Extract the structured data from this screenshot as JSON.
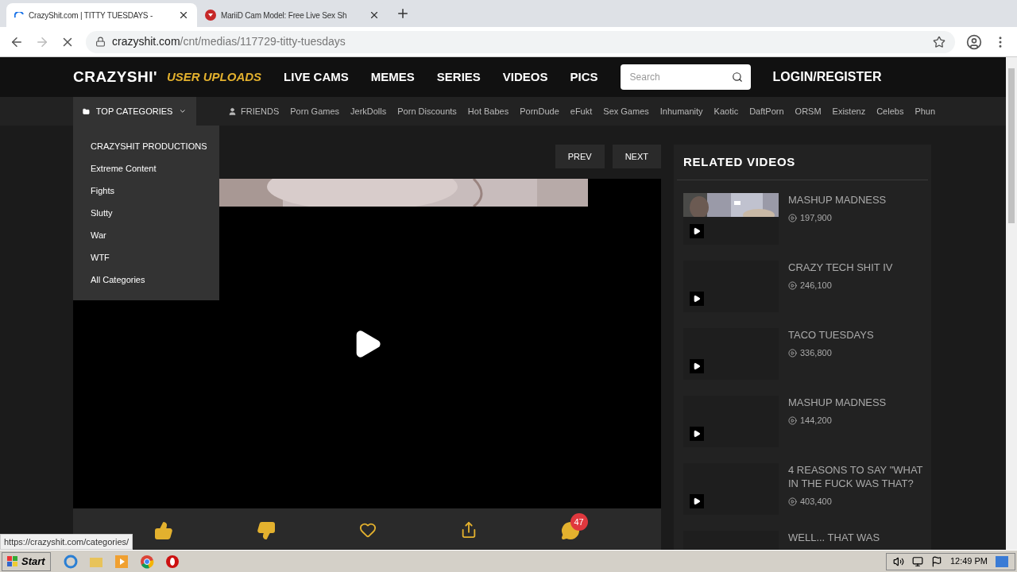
{
  "browser": {
    "tabs": [
      {
        "title": "CrazyShit.com | TITTY TUESDAYS -",
        "selected": true,
        "kind": "loading"
      },
      {
        "title": "MariiD Cam Model: Free Live Sex Sh",
        "selected": false,
        "kind": "site"
      }
    ],
    "url_host": "crazyshit.com",
    "url_path": "/cnt/medias/117729-titty-tuesdays",
    "loading": true
  },
  "navbar": {
    "logo": "CRAZYSHI'",
    "tagline": "USER UPLOADS",
    "links": [
      "LIVE CAMS",
      "MEMES",
      "SERIES",
      "VIDEOS",
      "PICS"
    ],
    "search": {
      "placeholder": "Search"
    },
    "login": "LOGIN/REGISTER"
  },
  "subnav": {
    "categories_button": "TOP CATEGORIES",
    "expanded": true,
    "friends": "FRIENDS",
    "links": [
      "Porn Games",
      "JerkDolls",
      "Porn Discounts",
      "Hot Babes",
      "PornDude",
      "eFukt",
      "Sex Games",
      "Inhumanity",
      "Kaotic",
      "DaftPorn",
      "ORSM",
      "Existenz",
      "Celebs",
      "Phun"
    ]
  },
  "categories_menu": [
    "CRAZYSHIT PRODUCTIONS",
    "Extreme Content",
    "Fights",
    "Slutty",
    "War",
    "WTF",
    "All Categories"
  ],
  "video": {
    "prev": "PREV",
    "next": "NEXT",
    "comment_count": "47"
  },
  "related": {
    "title": "RELATED VIDEOS",
    "items": [
      {
        "title": "MASHUP MADNESS",
        "views": "197,900",
        "thumb_loaded": true
      },
      {
        "title": "CRAZY TECH SHIT IV",
        "views": "246,100",
        "thumb_loaded": false
      },
      {
        "title": "TACO TUESDAYS",
        "views": "336,800",
        "thumb_loaded": false
      },
      {
        "title": "MASHUP MADNESS",
        "views": "144,200",
        "thumb_loaded": false
      },
      {
        "title": "4 REASONS TO SAY \"WHAT IN THE FUCK WAS THAT?",
        "views": "403,400",
        "thumb_loaded": false
      },
      {
        "title": "WELL... THAT WAS",
        "thumb_loaded": false
      }
    ]
  },
  "status_url": "https://crazyshit.com/categories/",
  "taskbar": {
    "start": "Start",
    "clock": "12:49 PM"
  }
}
